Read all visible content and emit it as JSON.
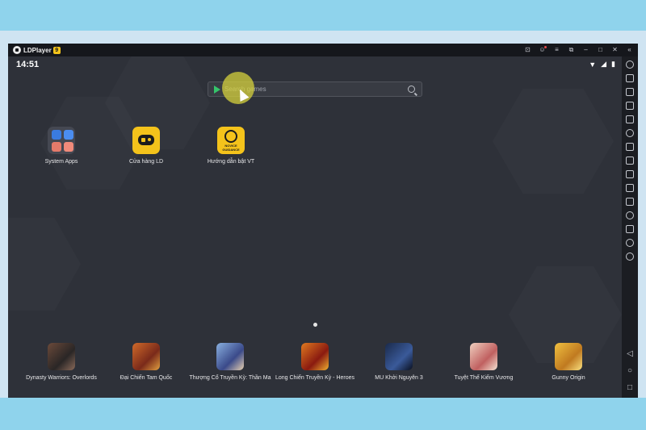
{
  "window": {
    "title": "LDPlayer",
    "badge": "9",
    "controls": [
      "gamepad-icon",
      "user-icon",
      "menu-icon",
      "restore-icon",
      "minimize-icon",
      "maximize-icon",
      "close-icon"
    ]
  },
  "statusbar": {
    "time": "14:51"
  },
  "search": {
    "placeholder": "Search games"
  },
  "apps": [
    {
      "label": "System Apps"
    },
    {
      "label": "Cửa hàng LD"
    },
    {
      "label": "Hướng dẫn bật VT",
      "icon_text": "NOVICE GUIDANCE"
    }
  ],
  "dock": [
    {
      "label": "Dynasty Warriors: Overlords"
    },
    {
      "label": "Đại Chiến Tam Quốc"
    },
    {
      "label": "Thượng Cổ Truyền Kỳ: Thần Ma"
    },
    {
      "label": "Long Chiến Truyền Kỳ - Heroes"
    },
    {
      "label": "MU Khởi Nguyên 3"
    },
    {
      "label": "Tuyệt Thế Kiếm Vương"
    },
    {
      "label": "Gunny Origin"
    }
  ],
  "sidebar_icons": [
    "settings-icon",
    "keyboard-icon",
    "volume-up-icon",
    "volume-down-icon",
    "fullscreen-icon",
    "rotate-icon",
    "screenshot-icon",
    "record-icon",
    "scissors-icon",
    "apk-icon",
    "operation-record-icon",
    "shake-icon",
    "folder-icon",
    "location-icon",
    "sync-icon"
  ],
  "colors": {
    "accent": "#f4c31b",
    "screen_bg": "#2e3139",
    "titlebar": "#15171c"
  }
}
